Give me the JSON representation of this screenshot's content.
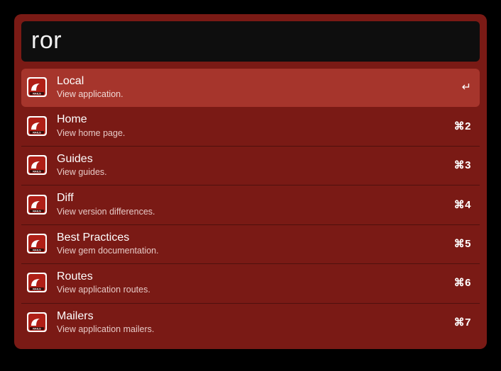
{
  "search": {
    "value": "ror"
  },
  "results": [
    {
      "title": "Local",
      "subtitle": "View application.",
      "shortcut": "↵",
      "selected": true,
      "shortcut_type": "enter"
    },
    {
      "title": "Home",
      "subtitle": "View home page.",
      "shortcut": "⌘2",
      "selected": false,
      "shortcut_type": "cmd"
    },
    {
      "title": "Guides",
      "subtitle": "View guides.",
      "shortcut": "⌘3",
      "selected": false,
      "shortcut_type": "cmd"
    },
    {
      "title": "Diff",
      "subtitle": "View version differences.",
      "shortcut": "⌘4",
      "selected": false,
      "shortcut_type": "cmd"
    },
    {
      "title": "Best Practices",
      "subtitle": "View gem documentation.",
      "shortcut": "⌘5",
      "selected": false,
      "shortcut_type": "cmd"
    },
    {
      "title": "Routes",
      "subtitle": "View application routes.",
      "shortcut": "⌘6",
      "selected": false,
      "shortcut_type": "cmd"
    },
    {
      "title": "Mailers",
      "subtitle": "View application mailers.",
      "shortcut": "⌘7",
      "selected": false,
      "shortcut_type": "cmd"
    }
  ],
  "icon_name": "rails-icon"
}
